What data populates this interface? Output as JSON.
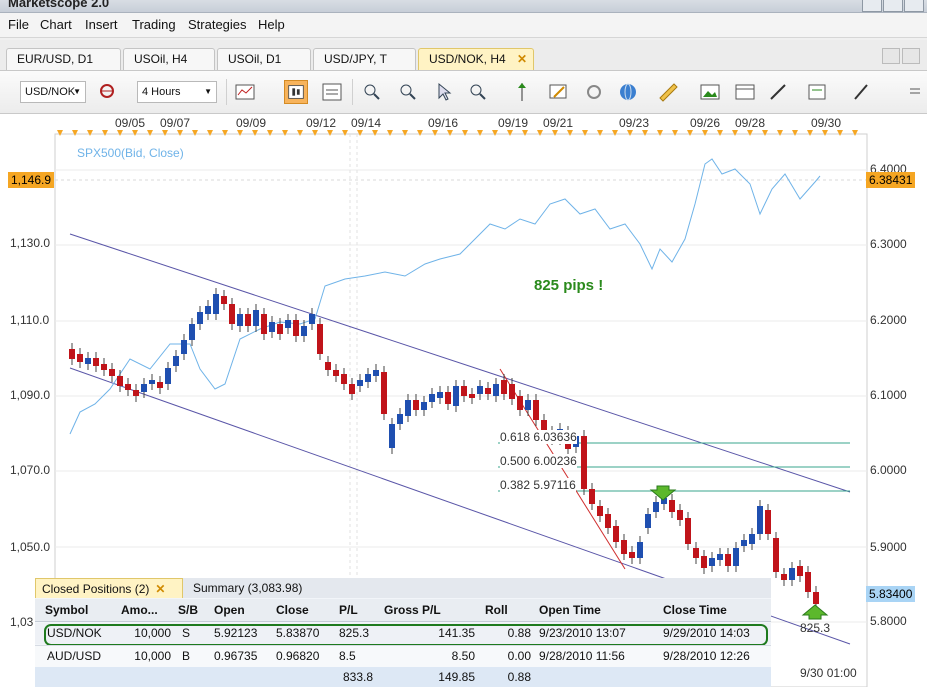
{
  "window": {
    "title": "Marketscope 2.0"
  },
  "menu": [
    "File",
    "Chart",
    "Insert",
    "Trading",
    "Strategies",
    "Help"
  ],
  "tabs": [
    {
      "label": "EUR/USD, D1",
      "active": false
    },
    {
      "label": "USOil, H4",
      "active": false
    },
    {
      "label": "USOil, D1",
      "active": false
    },
    {
      "label": "USD/JPY, T",
      "active": false
    },
    {
      "label": "USD/NOK, H4",
      "active": true
    }
  ],
  "toolbar": {
    "symbol": "USD/NOK",
    "timeframe": "4 Hours"
  },
  "chart": {
    "overlay_label": "SPX500(Bid, Close)",
    "x_dates": [
      "09/05",
      "09/07",
      "09/09",
      "09/12",
      "09/14",
      "09/16",
      "09/19",
      "09/21",
      "09/23",
      "09/26",
      "09/28",
      "09/30"
    ],
    "x_end_label": "9/30 01:00",
    "left_axis": [
      "1,130.0",
      "1,110.0",
      "1,090.0",
      "1,070.0",
      "1,050.0",
      "1,03"
    ],
    "right_axis": [
      "6.4000",
      "6.3000",
      "6.2000",
      "6.1000",
      "6.0000",
      "5.9000",
      "5.8000"
    ],
    "left_current": "1,146.9",
    "right_current": "6.38431",
    "right_last": "5.83400",
    "annotation": "825 pips !",
    "fib_levels": [
      "0.618 6.03636",
      "0.500 6.00236",
      "0.382 5.97116"
    ],
    "target_label": "825.3",
    "colors": {
      "bull": "#1f4fb0",
      "bear": "#c0141a",
      "spx": "#6fb3e8",
      "channel": "#5a56a8",
      "fib": "#3aa58e",
      "annotation": "#2a8a1c"
    }
  },
  "positions_panel": {
    "tabs": [
      {
        "label": "Closed Positions (2)",
        "active": true
      },
      {
        "label": "Summary (3,083.98)",
        "active": false
      }
    ],
    "columns": [
      "Symbol",
      "Amo...",
      "S/B",
      "Open",
      "Close",
      "P/L",
      "Gross P/L",
      "Roll",
      "Open Time",
      "Close Time"
    ],
    "rows": [
      [
        "USD/NOK",
        "10,000",
        "S",
        "5.92123",
        "5.83870",
        "825.3",
        "141.35",
        "0.88",
        "9/23/2010 13:07",
        "9/29/2010 14:03"
      ],
      [
        "AUD/USD",
        "10,000",
        "B",
        "0.96735",
        "0.96820",
        "8.5",
        "8.50",
        "0.00",
        "9/28/2010 11:56",
        "9/28/2010 12:26"
      ]
    ],
    "totals": {
      "pl": "833.8",
      "gross": "149.85",
      "roll": "0.88"
    }
  }
}
